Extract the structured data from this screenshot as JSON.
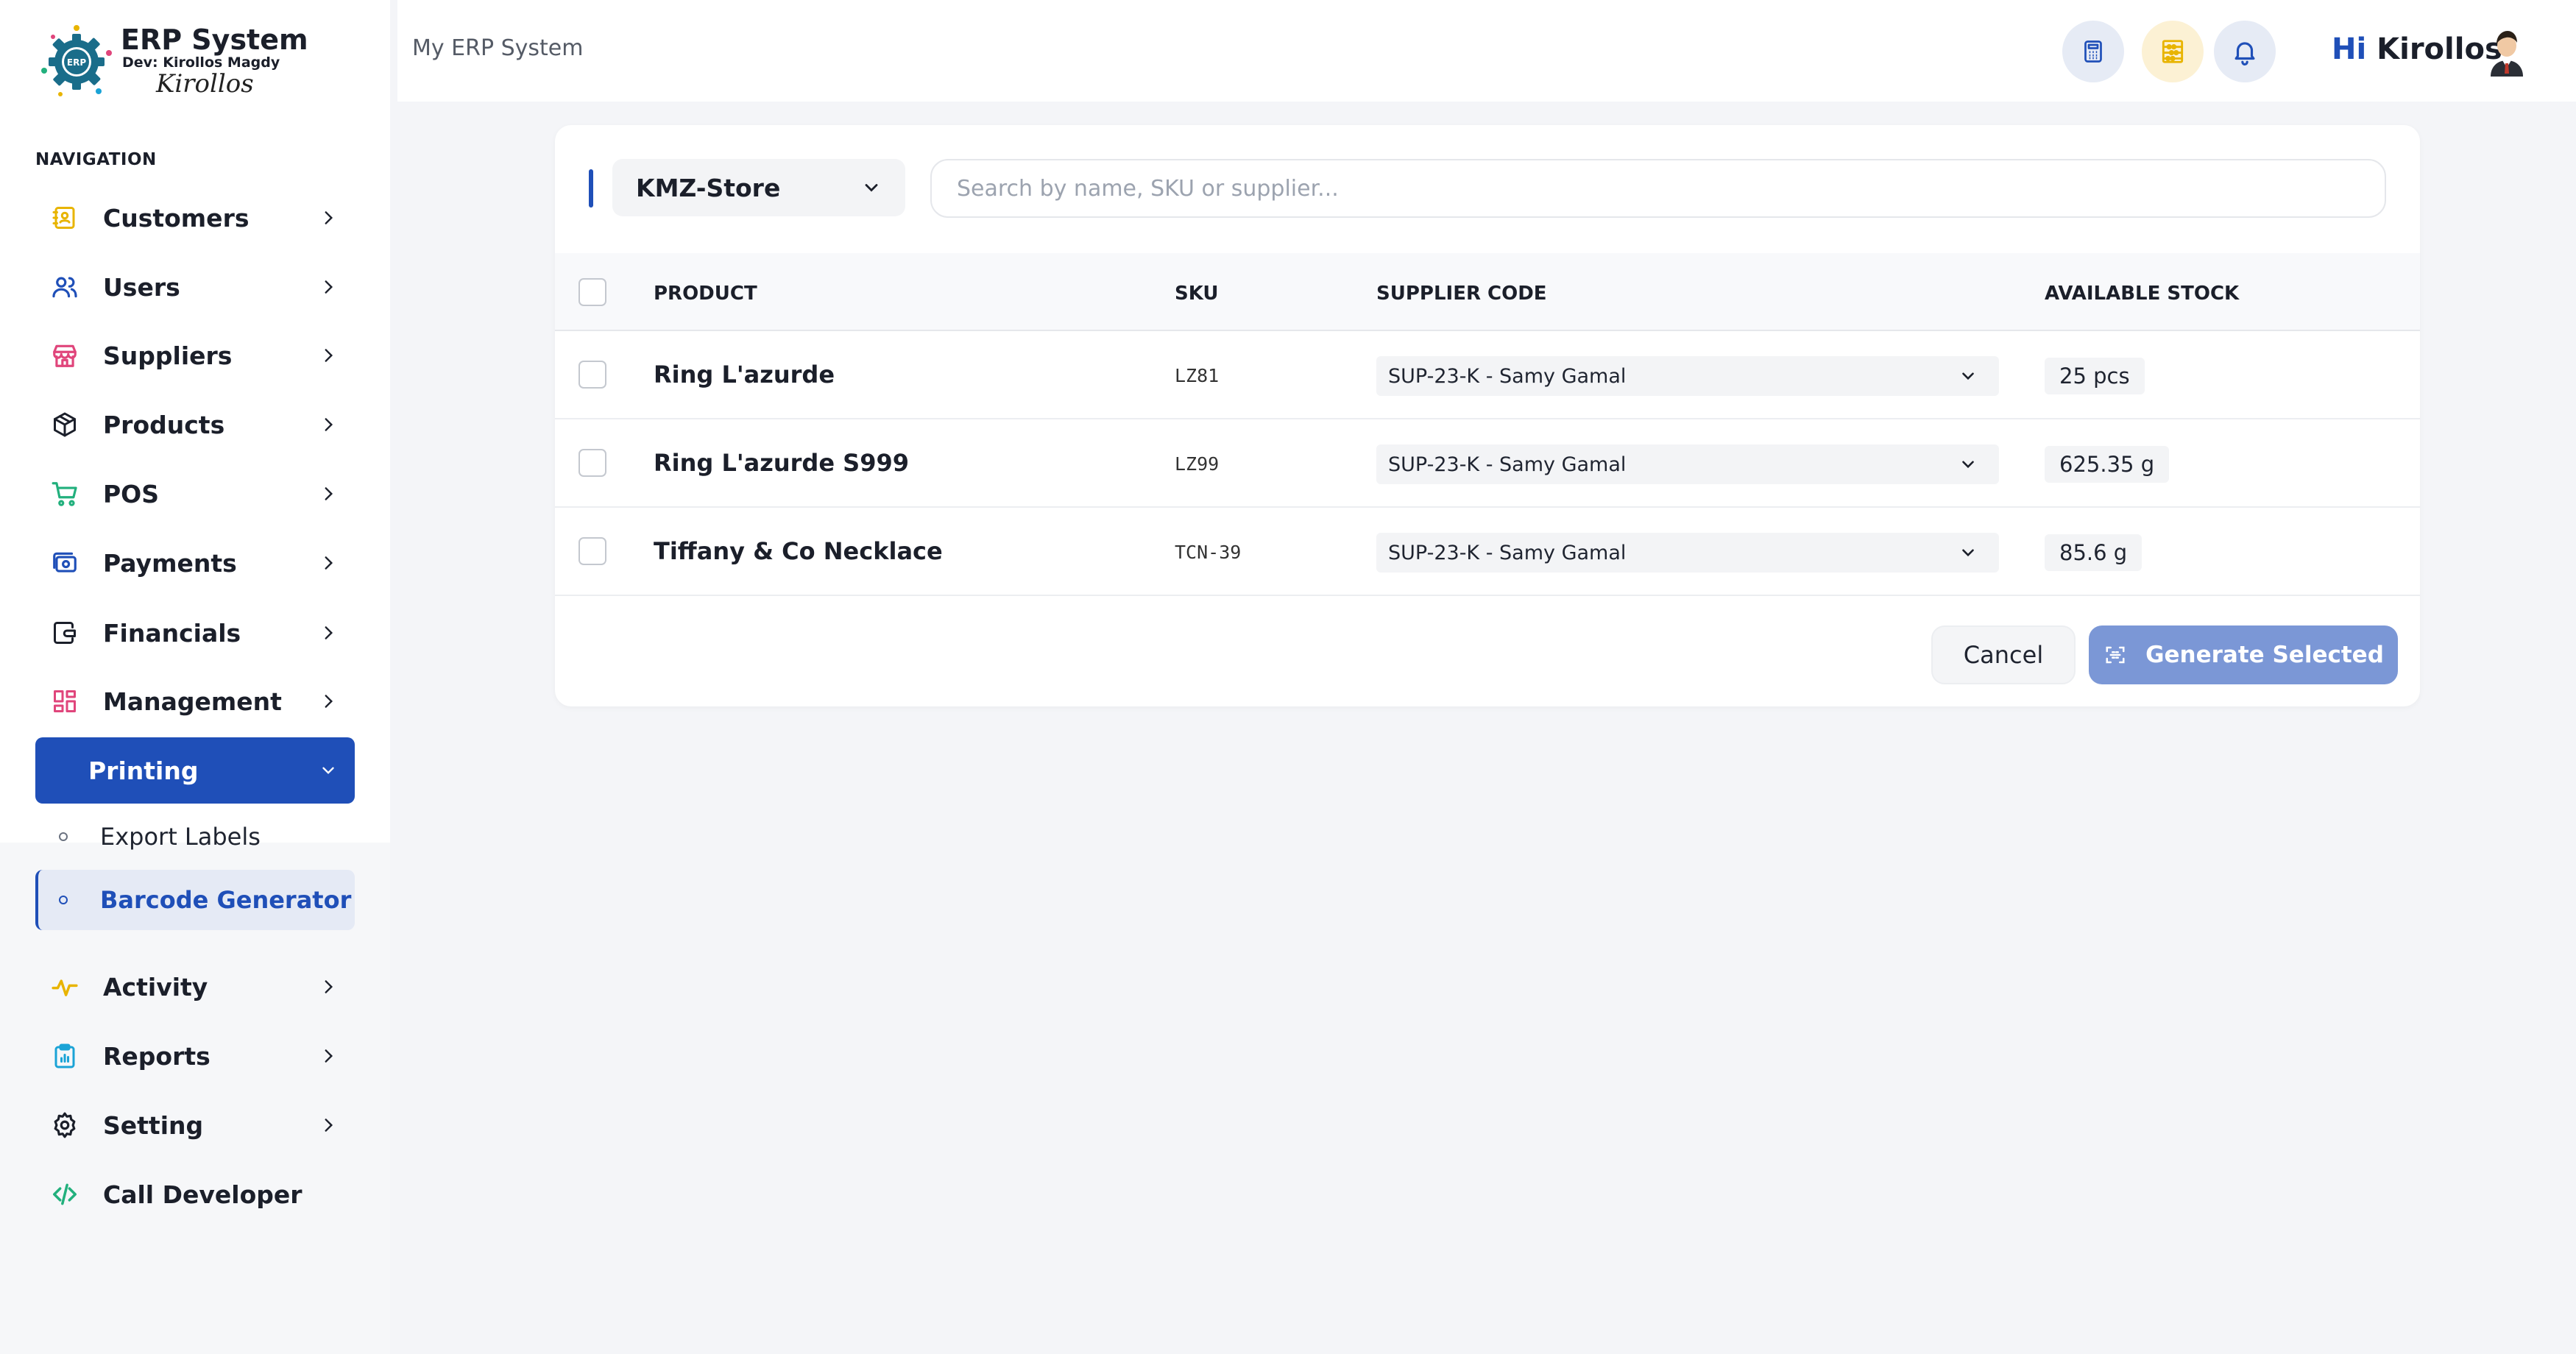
{
  "brand": {
    "title": "ERP System",
    "subtitle": "Dev: Kirollos Magdy",
    "signature": "Kirollos",
    "logo_text": "ERP"
  },
  "sidebar": {
    "heading": "NAVIGATION",
    "items": [
      {
        "label": "Customers",
        "icon": "contact-book-icon",
        "color": "#e8b400"
      },
      {
        "label": "Users",
        "icon": "users-icon",
        "color": "#1f4fb8"
      },
      {
        "label": "Suppliers",
        "icon": "store-icon",
        "color": "#e0457b"
      },
      {
        "label": "Products",
        "icon": "box-icon",
        "color": "#1b1f2a"
      },
      {
        "label": "POS",
        "icon": "cart-icon",
        "color": "#22b07d"
      },
      {
        "label": "Payments",
        "icon": "payments-icon",
        "color": "#1f4fb8"
      },
      {
        "label": "Financials",
        "icon": "wallet-icon",
        "color": "#1b1f2a"
      },
      {
        "label": "Management",
        "icon": "dashboard-icon",
        "color": "#e0457b"
      },
      {
        "label": "Printing",
        "icon": "",
        "active": true
      },
      {
        "label": "Activity",
        "icon": "activity-icon",
        "color": "#e8b400"
      },
      {
        "label": "Reports",
        "icon": "clipboard-icon",
        "color": "#1aa3d6"
      },
      {
        "label": "Setting",
        "icon": "gear-icon",
        "color": "#1b1f2a"
      },
      {
        "label": "Call Developer",
        "icon": "code-icon",
        "color": "#22b07d"
      }
    ],
    "subitems": [
      {
        "label": "Export Labels"
      },
      {
        "label": "Barcode Generator",
        "active": true
      }
    ]
  },
  "header": {
    "breadcrumb": "My ERP System",
    "greeting_hi": "Hi",
    "greeting_name": "Kirollos"
  },
  "toolbar": {
    "store": "KMZ-Store",
    "search_placeholder": "Search by name, SKU or supplier..."
  },
  "table": {
    "columns": [
      "PRODUCT",
      "SKU",
      "SUPPLIER CODE",
      "AVAILABLE STOCK"
    ],
    "rows": [
      {
        "product": "Ring L'azurde",
        "sku": "LZ81",
        "supplier": "SUP-23-K - Samy Gamal",
        "stock": "25 pcs"
      },
      {
        "product": "Ring L'azurde S999",
        "sku": "LZ99",
        "supplier": "SUP-23-K - Samy Gamal",
        "stock": "625.35 g"
      },
      {
        "product": "Tiffany & Co Necklace",
        "sku": "TCN-39",
        "supplier": "SUP-23-K - Samy Gamal",
        "stock": "85.6 g"
      }
    ]
  },
  "actions": {
    "cancel": "Cancel",
    "generate": "Generate Selected"
  },
  "colors": {
    "accent": "#1f4fb8",
    "generate_button": "#7b97d6"
  }
}
